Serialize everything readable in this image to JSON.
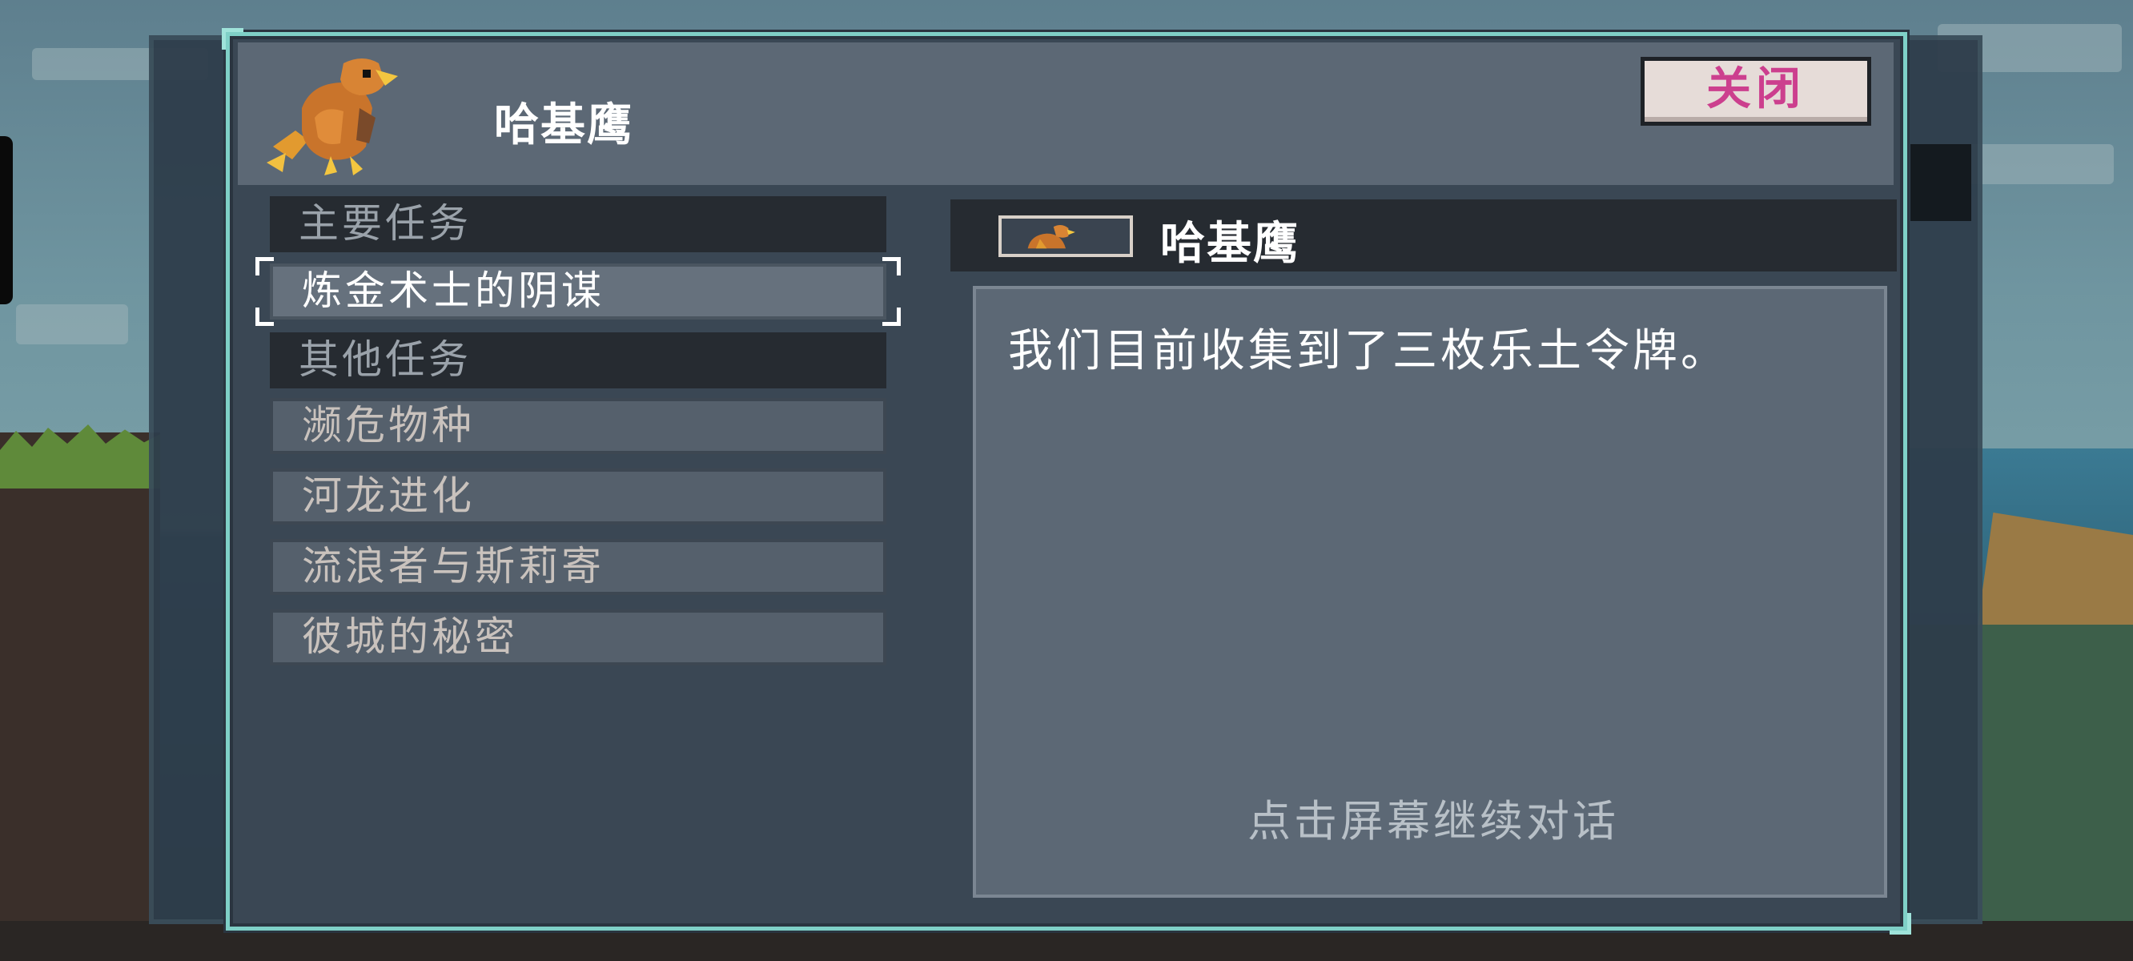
{
  "header": {
    "speaker": "哈基鹰",
    "close_label": "关闭"
  },
  "quests": {
    "main_category": "主要任务",
    "main_items": [
      "炼金术士的阴谋"
    ],
    "other_category": "其他任务",
    "other_items": [
      "濒危物种",
      "河龙进化",
      "流浪者与斯莉寄",
      "彼城的秘密"
    ]
  },
  "dialogue": {
    "speaker": "哈基鹰",
    "text": "我们目前收集到了三枚乐土令牌。",
    "continue_hint": "点击屏幕继续对话"
  },
  "colors": {
    "frame_accent": "#7fd0c7",
    "close_text": "#cc3f8e",
    "panel": "#5c6875"
  },
  "icons": {
    "portrait": "eagle-portrait-icon"
  }
}
